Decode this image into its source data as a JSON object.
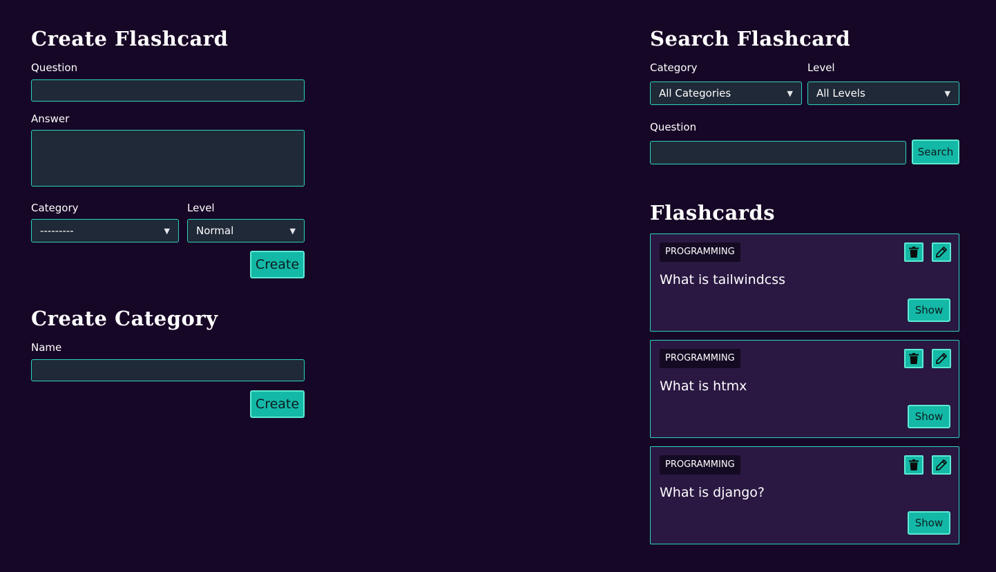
{
  "create_flashcard": {
    "title": "Create Flashcard",
    "question_label": "Question",
    "question_value": "",
    "answer_label": "Answer",
    "answer_value": "",
    "category_label": "Category",
    "category_selected": "---------",
    "level_label": "Level",
    "level_selected": "Normal",
    "create_label": "Create"
  },
  "create_category": {
    "title": "Create Category",
    "name_label": "Name",
    "name_value": "",
    "create_label": "Create"
  },
  "search_flashcard": {
    "title": "Search Flashcard",
    "category_label": "Category",
    "category_selected": "All Categories",
    "level_label": "Level",
    "level_selected": "All Levels",
    "question_label": "Question",
    "question_value": "",
    "search_label": "Search"
  },
  "flashcards": {
    "title": "Flashcards",
    "items": [
      {
        "category": "PROGRAMMING",
        "question": "What is tailwindcss",
        "show_label": "Show"
      },
      {
        "category": "PROGRAMMING",
        "question": "What is htmx",
        "show_label": "Show"
      },
      {
        "category": "PROGRAMMING",
        "question": "What is django?",
        "show_label": "Show"
      }
    ]
  },
  "icons": {
    "delete": "trash-icon",
    "edit": "pencil-icon",
    "select": "chevron-down-icon"
  },
  "colors": {
    "background": "#170726",
    "accent": "#14b8a6",
    "field_border": "#2ad4c0",
    "field_bg": "#1f2937",
    "card_bg": "#2a1842"
  }
}
